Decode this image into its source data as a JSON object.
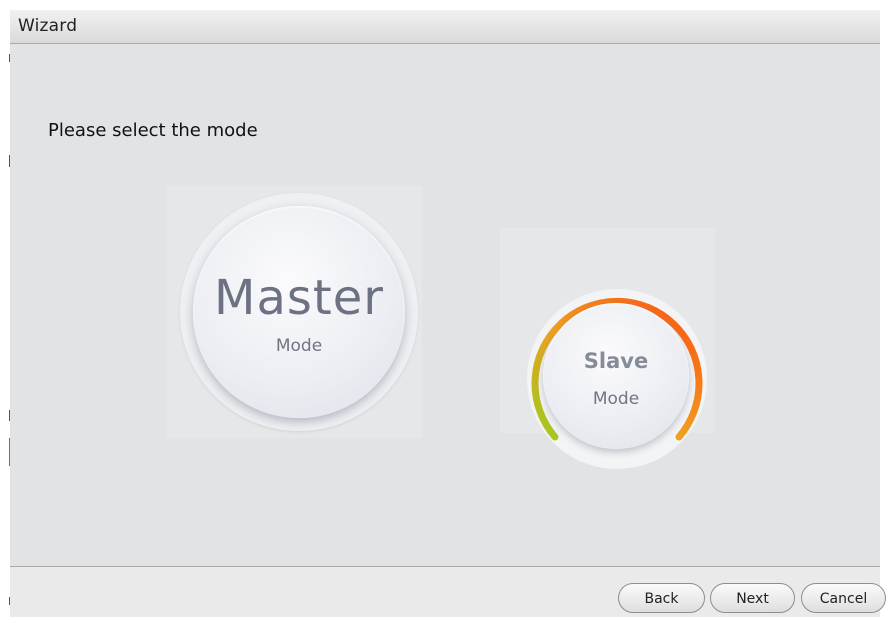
{
  "window": {
    "title": "Wizard"
  },
  "content": {
    "prompt": "Please select the mode"
  },
  "modes": {
    "master": {
      "title": "Master",
      "subtitle": "Mode",
      "selected": true
    },
    "slave": {
      "title": "Slave",
      "subtitle": "Mode",
      "selected": false,
      "ring_colors": [
        "#9fca1f",
        "#f0a020",
        "#ff4f12"
      ]
    }
  },
  "footer": {
    "back_label": "Back",
    "next_label": "Next",
    "cancel_label": "Cancel"
  },
  "colors": {
    "content_background": "#e2e3e5",
    "mode_text": "#6d7282",
    "button_border": "#8d8d8d"
  },
  "icons": {
    "mode_gauge": "slave-gauge-ring-icon"
  }
}
